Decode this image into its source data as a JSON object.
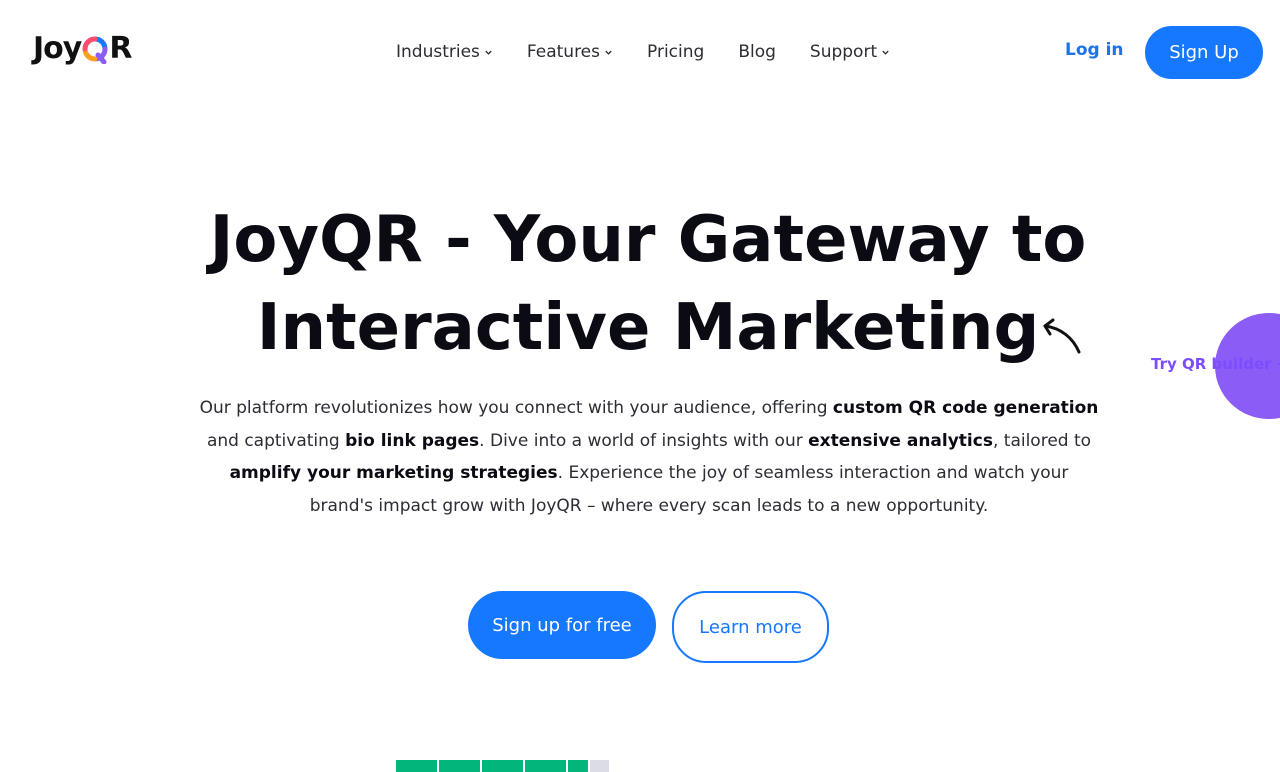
{
  "header": {
    "logo": {
      "left": "Joy",
      "right": "R"
    },
    "nav": [
      {
        "label": "Industries",
        "has_dropdown": true
      },
      {
        "label": "Features",
        "has_dropdown": true
      },
      {
        "label": "Pricing",
        "has_dropdown": false
      },
      {
        "label": "Blog",
        "has_dropdown": false
      },
      {
        "label": "Support",
        "has_dropdown": true
      }
    ],
    "login_label": "Log in",
    "signup_label": "Sign Up"
  },
  "hero": {
    "title_line1": "JoyQR - Your Gateway to",
    "title_line2": "Interactive Marketing",
    "desc": {
      "p1": "Our platform revolutionizes how you connect with your audience, offering ",
      "b1": "custom QR code generation",
      "p2": " and captivating ",
      "b2": "bio link pages",
      "p3": ". Dive into a world of insights with our ",
      "b3": "extensive analytics",
      "p4": ", tailored to ",
      "b4": "amplify your marketing strategies",
      "p5": ". Experience the joy of seamless interaction and watch your brand's impact grow with JoyQR – where every scan leads to a new opportunity."
    },
    "primary_cta": "Sign up for free",
    "secondary_cta": "Learn more"
  },
  "floating_tab": {
    "label": "Try QR builder ⟶"
  },
  "colors": {
    "primary": "#1677ff",
    "text": "#0b0b14",
    "purple": "#8b5cf6",
    "rating_green": "#00b67a"
  },
  "icons": {
    "nav_dropdown": "chevron-down-icon",
    "decoration": "curved-arrow-icon",
    "rating": "star-rating-icon"
  }
}
